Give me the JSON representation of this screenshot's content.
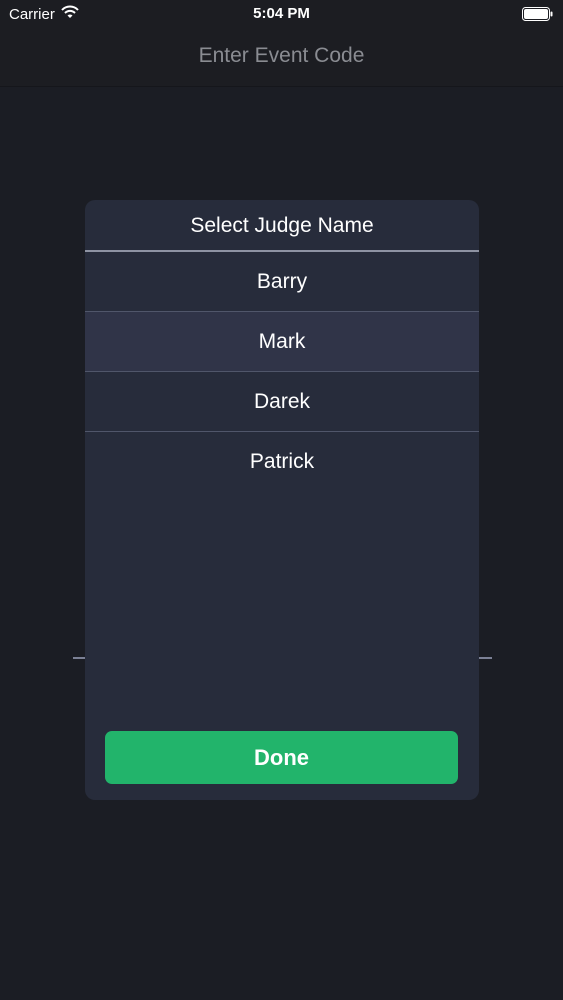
{
  "status_bar": {
    "carrier": "Carrier",
    "time": "5:04 PM",
    "icons": [
      "wifi-icon",
      "battery-icon"
    ]
  },
  "nav": {
    "title": "Enter Event Code"
  },
  "modal": {
    "title": "Select Judge Name",
    "judges": [
      {
        "name": "Barry",
        "selected": false
      },
      {
        "name": "Mark",
        "selected": true
      },
      {
        "name": "Darek",
        "selected": false
      },
      {
        "name": "Patrick",
        "selected": false
      }
    ],
    "done_label": "Done"
  },
  "colors": {
    "background": "#1b1d24",
    "modal": "#272c3b",
    "selected_row": "#303448",
    "accent": "#22b46b"
  }
}
